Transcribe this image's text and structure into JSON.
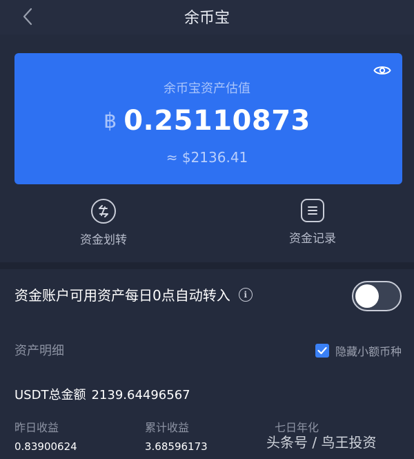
{
  "header": {
    "title": "余币宝"
  },
  "card": {
    "label": "余币宝资产估值",
    "currency_symbol": "฿",
    "balance": "0.25110873",
    "usd_value": "≈ $2136.41",
    "color": "#2e71f2"
  },
  "actions": [
    {
      "label": "资金划转",
      "icon": "transfer-icon"
    },
    {
      "label": "资金记录",
      "icon": "records-icon"
    }
  ],
  "auto_transfer": {
    "label": "资金账户可用资产每日0点自动转入",
    "enabled": false
  },
  "assets": {
    "title": "资产明细",
    "hide_small_label": "隐藏小额币种",
    "hide_small_checked": true,
    "total_label": "USDT总金额",
    "total_value": "2139.64496567"
  },
  "stats": [
    {
      "label": "昨日收益",
      "value": "0.83900624"
    },
    {
      "label": "累计收益",
      "value": "3.68596173"
    },
    {
      "label": "七日年化",
      "value": ""
    }
  ],
  "watermark": "头条号 / 鸟王投资"
}
